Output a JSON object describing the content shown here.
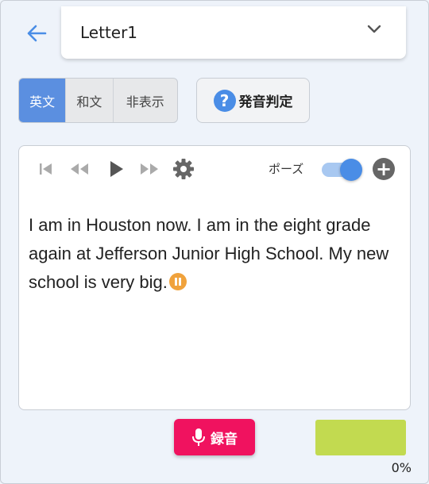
{
  "header": {
    "back_icon": "arrow-left-icon",
    "title": "Letter1",
    "dropdown_icon": "chevron-down-icon"
  },
  "display_mode": {
    "options": [
      "英文",
      "和文",
      "非表示"
    ],
    "selected": "英文"
  },
  "judge_button": {
    "icon": "question-circle-icon",
    "label": "発音判定"
  },
  "player": {
    "controls": [
      "skip-start-icon",
      "rewind-icon",
      "play-icon",
      "fast-forward-icon",
      "gear-icon"
    ],
    "pause_label": "ポーズ",
    "pause_enabled": true,
    "add_icon": "plus-circle-icon"
  },
  "passage": {
    "text": "I am in Houston now. I am in the eight grade again at Jefferson Junior High School. My new school is very big."
  },
  "record_button": {
    "icon": "mic-icon",
    "label": "録音"
  },
  "score": {
    "percent_label": "0%"
  },
  "colors": {
    "accent": "#5b8fe0",
    "record": "#f0125f",
    "score_bar": "#c2da50",
    "pause_marker": "#f0a23c"
  }
}
